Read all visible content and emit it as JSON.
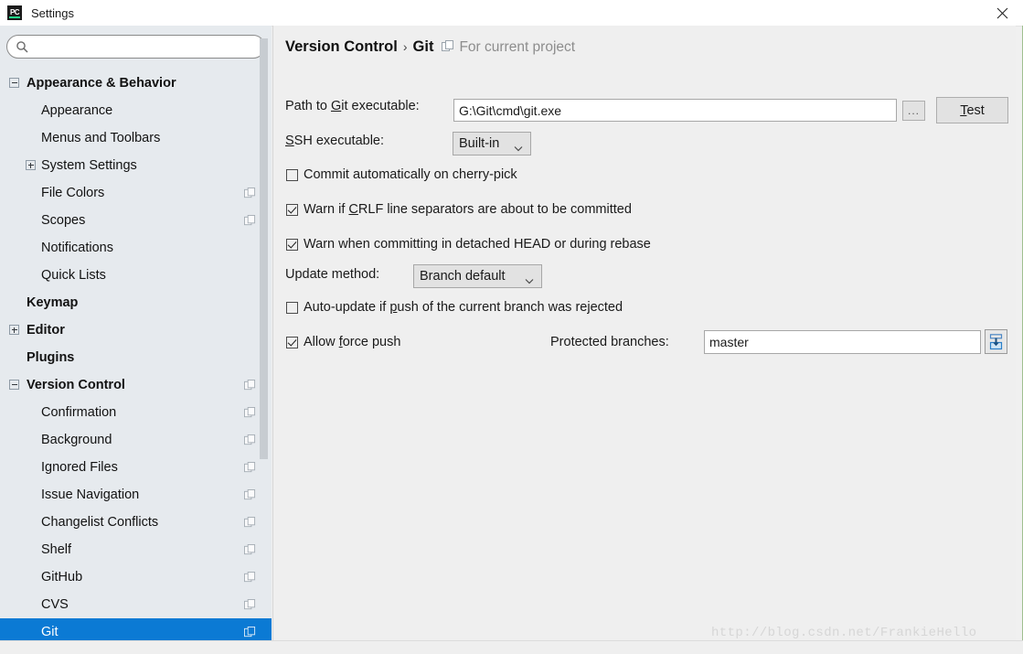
{
  "window": {
    "title": "Settings",
    "app_icon": "pycharm-icon",
    "close_icon": "close-icon"
  },
  "sidebar": {
    "search": {
      "value": "",
      "placeholder": "",
      "icon": "search-icon"
    },
    "items": [
      {
        "label": "Appearance & Behavior",
        "level": 0,
        "bold": true,
        "expander": "minus",
        "copy": false,
        "selected": false
      },
      {
        "label": "Appearance",
        "level": 1,
        "bold": false,
        "expander": "none",
        "copy": false,
        "selected": false
      },
      {
        "label": "Menus and Toolbars",
        "level": 1,
        "bold": false,
        "expander": "none",
        "copy": false,
        "selected": false
      },
      {
        "label": "System Settings",
        "level": 1,
        "bold": false,
        "expander": "plus",
        "copy": false,
        "selected": false
      },
      {
        "label": "File Colors",
        "level": 1,
        "bold": false,
        "expander": "none",
        "copy": true,
        "selected": false
      },
      {
        "label": "Scopes",
        "level": 1,
        "bold": false,
        "expander": "none",
        "copy": true,
        "selected": false
      },
      {
        "label": "Notifications",
        "level": 1,
        "bold": false,
        "expander": "none",
        "copy": false,
        "selected": false
      },
      {
        "label": "Quick Lists",
        "level": 1,
        "bold": false,
        "expander": "none",
        "copy": false,
        "selected": false
      },
      {
        "label": "Keymap",
        "level": 0,
        "bold": true,
        "expander": "none",
        "copy": false,
        "selected": false
      },
      {
        "label": "Editor",
        "level": 0,
        "bold": true,
        "expander": "plus",
        "copy": false,
        "selected": false
      },
      {
        "label": "Plugins",
        "level": 0,
        "bold": true,
        "expander": "none",
        "copy": false,
        "selected": false
      },
      {
        "label": "Version Control",
        "level": 0,
        "bold": true,
        "expander": "minus",
        "copy": true,
        "selected": false
      },
      {
        "label": "Confirmation",
        "level": 1,
        "bold": false,
        "expander": "none",
        "copy": true,
        "selected": false
      },
      {
        "label": "Background",
        "level": 1,
        "bold": false,
        "expander": "none",
        "copy": true,
        "selected": false
      },
      {
        "label": "Ignored Files",
        "level": 1,
        "bold": false,
        "expander": "none",
        "copy": true,
        "selected": false
      },
      {
        "label": "Issue Navigation",
        "level": 1,
        "bold": false,
        "expander": "none",
        "copy": true,
        "selected": false
      },
      {
        "label": "Changelist Conflicts",
        "level": 1,
        "bold": false,
        "expander": "none",
        "copy": true,
        "selected": false
      },
      {
        "label": "Shelf",
        "level": 1,
        "bold": false,
        "expander": "none",
        "copy": true,
        "selected": false
      },
      {
        "label": "GitHub",
        "level": 1,
        "bold": false,
        "expander": "none",
        "copy": true,
        "selected": false
      },
      {
        "label": "CVS",
        "level": 1,
        "bold": false,
        "expander": "none",
        "copy": true,
        "selected": false
      },
      {
        "label": "Git",
        "level": 1,
        "bold": false,
        "expander": "none",
        "copy": true,
        "selected": true
      }
    ],
    "scrollbar": {
      "name": "sidebar-scrollbar"
    }
  },
  "main": {
    "breadcrumb": {
      "root": "Version Control",
      "separator": "›",
      "current": "Git",
      "copy_icon": "copy-icon",
      "note": "For current project"
    },
    "git_path": {
      "label_pre": "Path to ",
      "label_mnemonic": "G",
      "label_post": "it executable:",
      "value": "G:\\Git\\cmd\\git.exe",
      "browse_label": "...",
      "test_mnemonic": "T",
      "test_post": "est"
    },
    "ssh": {
      "label_mnemonic": "S",
      "label_post": "SH executable:",
      "value": "Built-in"
    },
    "checkbox_cherry_pick": {
      "checked": false,
      "label": "Commit automatically on cherry-pick"
    },
    "checkbox_crlf": {
      "checked": true,
      "label_pre": "Warn if ",
      "label_mnemonic": "C",
      "label_post": "RLF line separators are about to be committed"
    },
    "checkbox_detached_head": {
      "checked": true,
      "label": "Warn when committing in detached HEAD or during rebase"
    },
    "update_method": {
      "label": "Update method:",
      "value": "Branch default"
    },
    "checkbox_auto_update": {
      "checked": false,
      "label_pre": "Auto-update if ",
      "label_mnemonic": "p",
      "label_post": "ush of the current branch was rejected"
    },
    "checkbox_force_push": {
      "checked": true,
      "label_pre": "Allow ",
      "label_mnemonic": "f",
      "label_post": "orce push"
    },
    "protected_branches": {
      "label": "Protected branches:",
      "value": "master",
      "expand_icon": "insert-into-box-icon"
    }
  },
  "watermark": {
    "text": "http://blog.csdn.net/FrankieHello"
  },
  "colors": {
    "selection_blue": "#0b7ad4",
    "sidebar_bg": "#e6eaee",
    "panel_bg": "#efefef",
    "accent_icon_blue": "#2a7fc9"
  }
}
